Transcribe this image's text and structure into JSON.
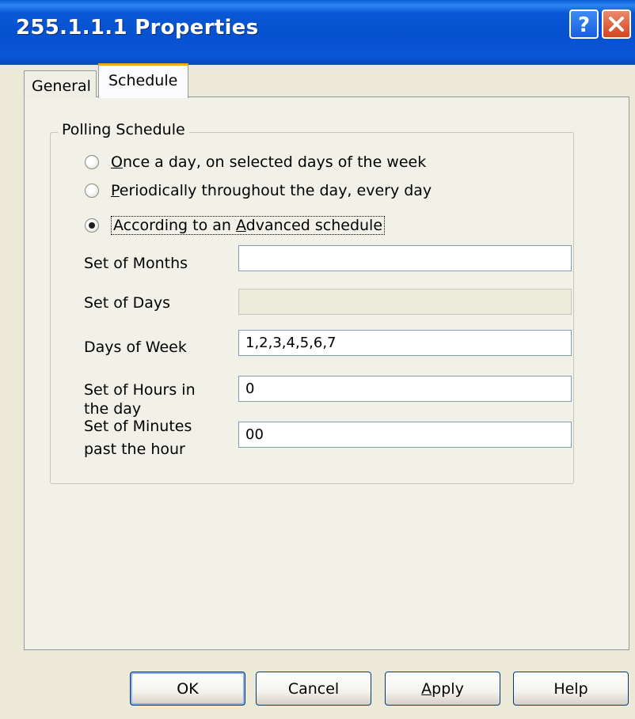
{
  "window": {
    "title": "255.1.1.1 Properties"
  },
  "titlebar_icons": [
    "help-icon",
    "close-icon"
  ],
  "tabs": [
    {
      "label": "General",
      "active": false
    },
    {
      "label": "Schedule",
      "active": true
    }
  ],
  "group": {
    "label": "Polling Schedule",
    "radios": [
      {
        "pre": "",
        "ul": "O",
        "post": "nce a day, on selected days of the week",
        "checked": false
      },
      {
        "pre": "",
        "ul": "P",
        "post": "eriodically throughout the day, every day",
        "checked": false
      },
      {
        "pre": "According to an ",
        "ul": "A",
        "post": "dvanced schedule",
        "checked": true
      }
    ],
    "fields": [
      {
        "label_line1": "Set of Months",
        "label_line2": "",
        "value": "",
        "enabled": true
      },
      {
        "label_line1": "Set of Days",
        "label_line2": "",
        "value": "",
        "enabled": false
      },
      {
        "label_line1": "Days of Week",
        "label_line2": "",
        "value": "1,2,3,4,5,6,7",
        "enabled": true
      },
      {
        "label_line1": "Set of Hours in",
        "label_line2": "the day",
        "value": "0",
        "enabled": true
      },
      {
        "label_line1": "Set of Minutes",
        "label_line2": "past the hour",
        "value": "00",
        "enabled": true
      }
    ]
  },
  "buttons": {
    "ok": "OK",
    "cancel": "Cancel",
    "apply_ul": "A",
    "apply_rest": "pply",
    "help": "Help"
  },
  "colors": {
    "titlebar": "#0551cf",
    "dialog_bg": "#ece9d8",
    "active_tab_accent": "#f4a626"
  }
}
